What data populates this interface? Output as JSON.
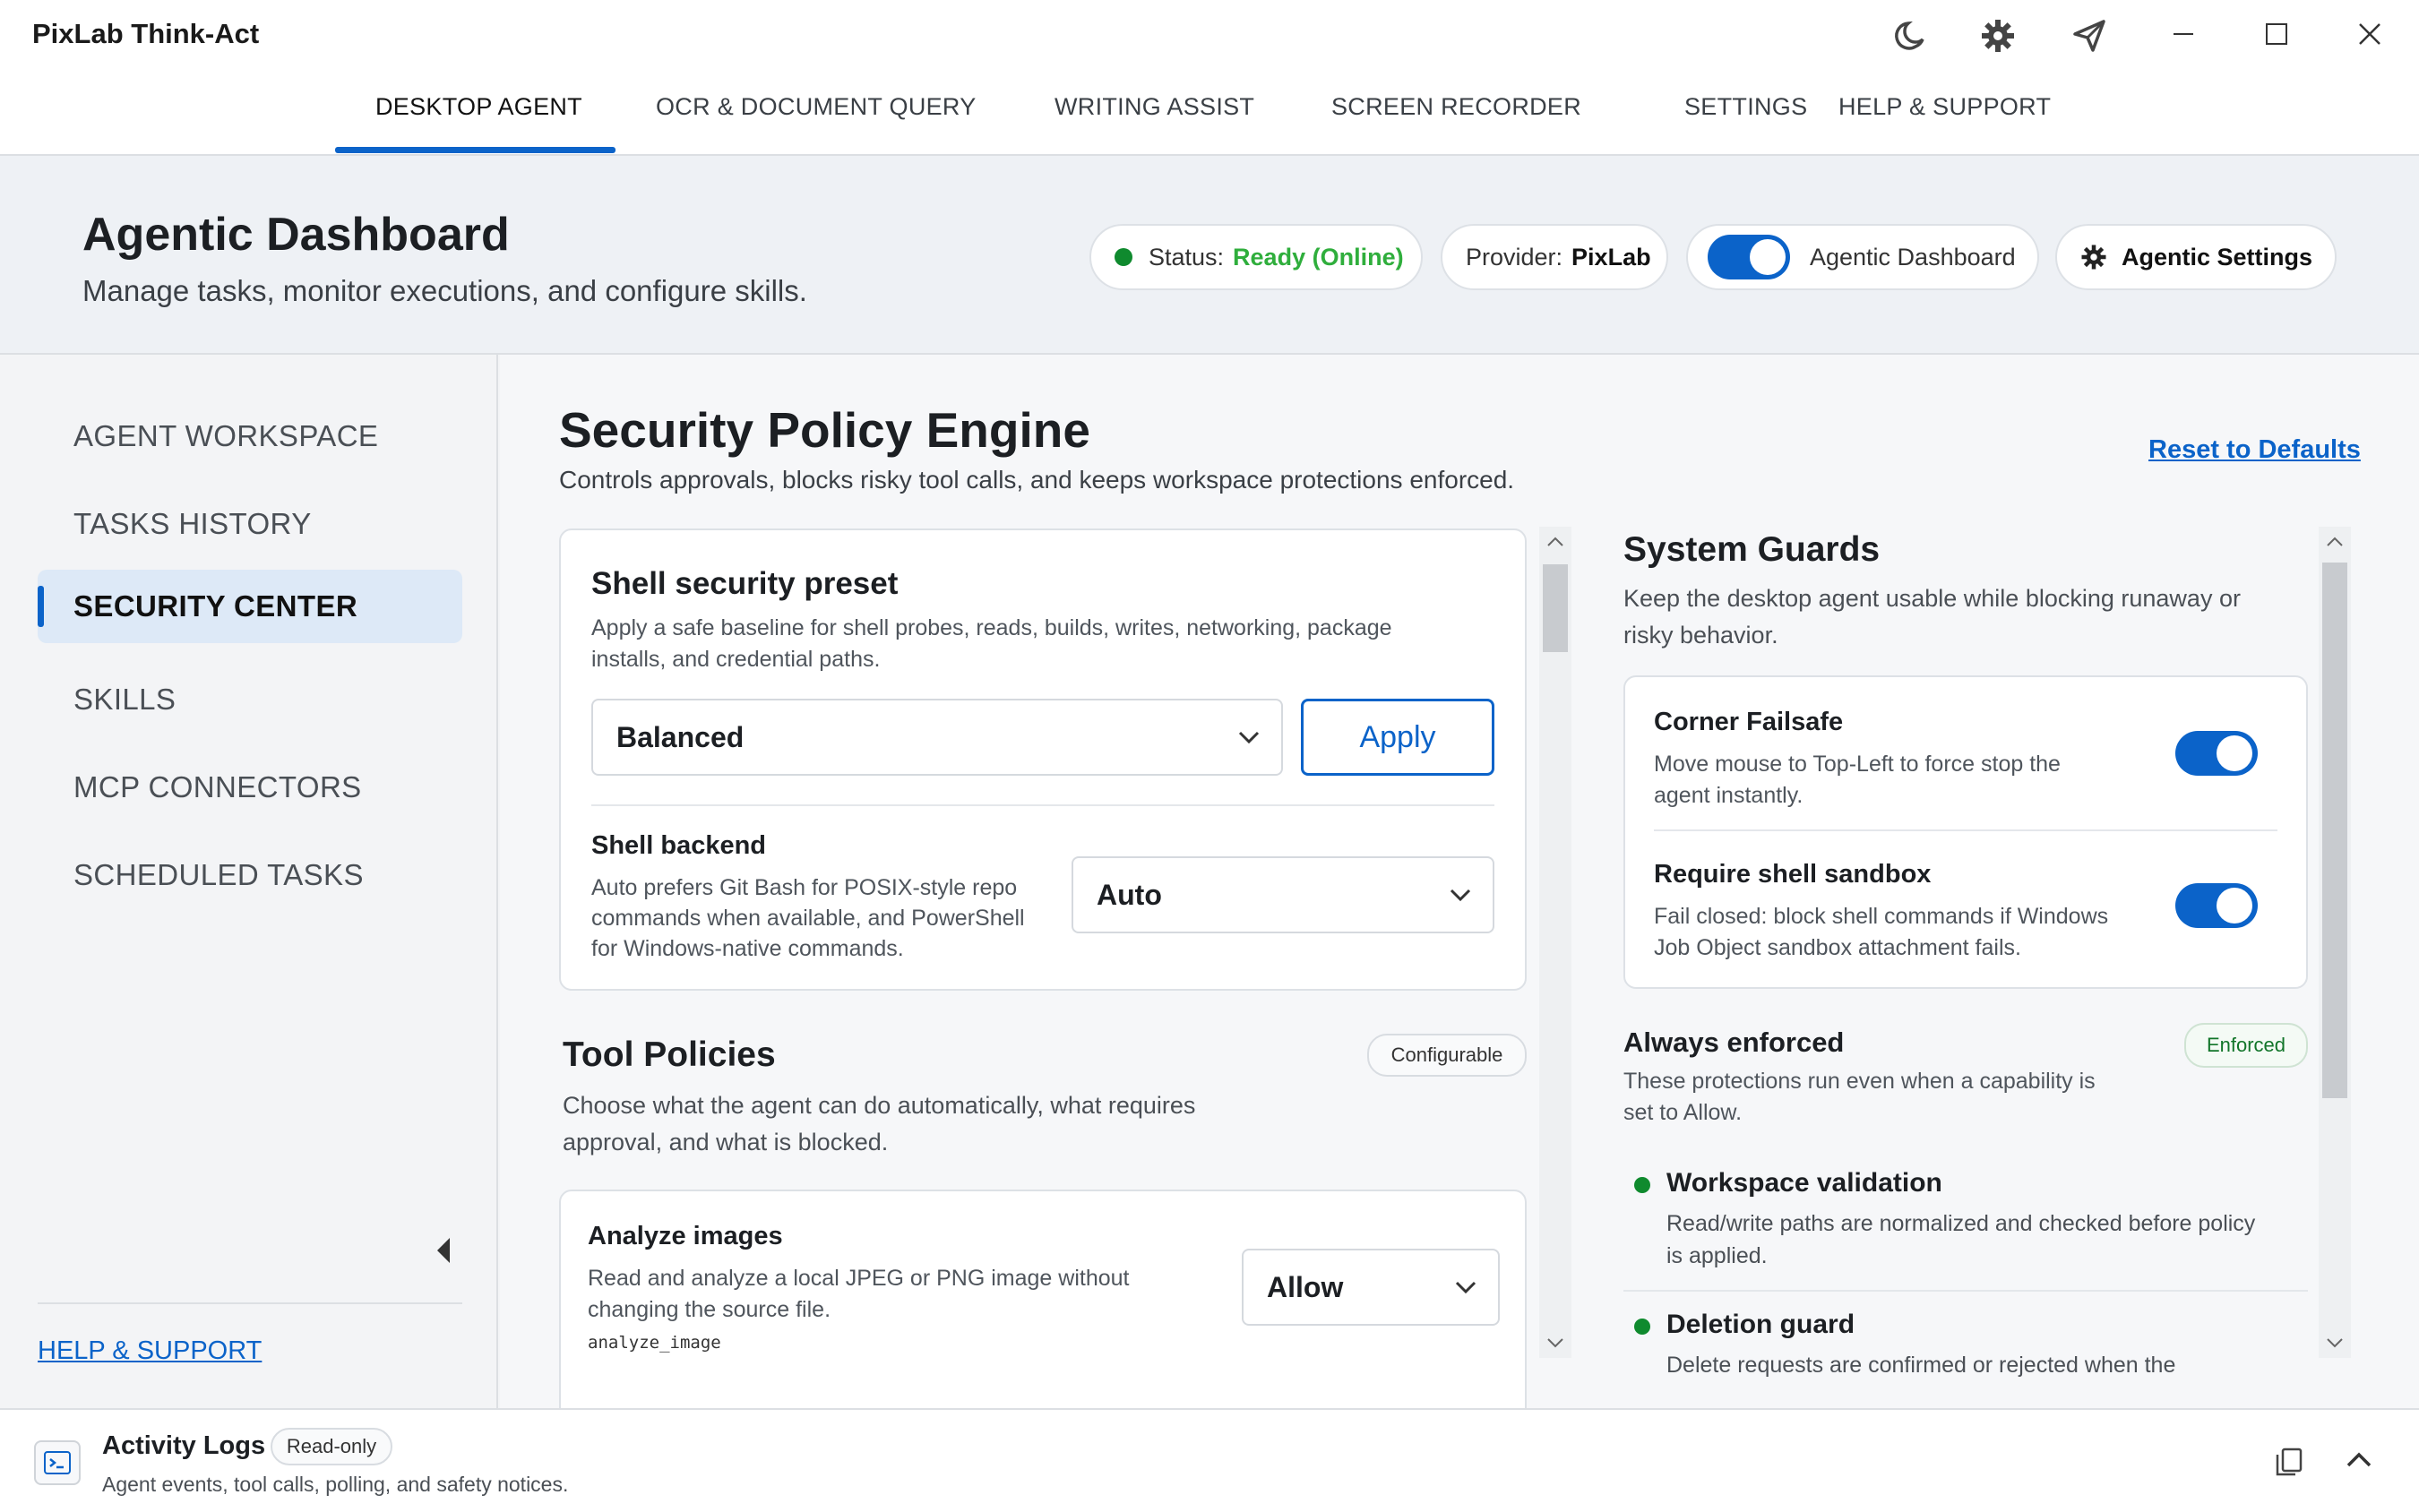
{
  "app": {
    "title": "PixLab Think-Act"
  },
  "titlebar_icons": [
    "moon-icon",
    "gear-icon",
    "send-icon"
  ],
  "window_controls": [
    "minimize",
    "maximize",
    "close"
  ],
  "tabs": [
    {
      "label": "DESKTOP AGENT",
      "active": true
    },
    {
      "label": "OCR & DOCUMENT QUERY",
      "active": false
    },
    {
      "label": "WRITING ASSIST",
      "active": false
    },
    {
      "label": "SCREEN RECORDER",
      "active": false
    },
    {
      "label": "SETTINGS",
      "active": false
    },
    {
      "label": "HELP & SUPPORT",
      "active": false
    }
  ],
  "header": {
    "title": "Agentic Dashboard",
    "subtitle": "Manage tasks, monitor executions, and configure skills.",
    "status_label": "Status:",
    "status_value": "Ready (Online)",
    "provider_label": "Provider:",
    "provider_value": "PixLab",
    "toggle_label": "Agentic Dashboard",
    "toggle_on": true,
    "settings_button": "Agentic Settings"
  },
  "sidebar": {
    "items": [
      {
        "label": "AGENT WORKSPACE",
        "active": false
      },
      {
        "label": "TASKS HISTORY",
        "active": false
      },
      {
        "label": "SECURITY CENTER",
        "active": true
      },
      {
        "label": "SKILLS",
        "active": false
      },
      {
        "label": "MCP CONNECTORS",
        "active": false
      },
      {
        "label": "SCHEDULED TASKS",
        "active": false
      }
    ],
    "help_link": "HELP & SUPPORT"
  },
  "main": {
    "title": "Security Policy Engine",
    "subtitle": "Controls approvals, blocks risky tool calls, and keeps workspace protections enforced.",
    "reset_link": "Reset to Defaults",
    "shell_preset": {
      "title": "Shell security preset",
      "desc1": "Apply a safe baseline for shell probes, reads, builds, writes, networking, package",
      "desc2": "installs, and credential paths.",
      "selected": "Balanced",
      "apply": "Apply",
      "backend_title": "Shell backend",
      "backend_desc1": "Auto prefers Git Bash for POSIX-style repo",
      "backend_desc2": "commands when available, and PowerShell",
      "backend_desc3": "for Windows-native commands.",
      "backend_selected": "Auto"
    },
    "tool_policies": {
      "title": "Tool Policies",
      "badge": "Configurable",
      "desc1": "Choose what the agent can do automatically, what requires",
      "desc2": "approval, and what is blocked.",
      "items": [
        {
          "title": "Analyze images",
          "desc1": "Read and analyze a local JPEG or PNG image without",
          "desc2": "changing the source file.",
          "code": "analyze_image",
          "policy": "Allow"
        }
      ]
    },
    "system_guards": {
      "title": "System Guards",
      "desc1": "Keep the desktop agent usable while blocking runaway or",
      "desc2": "risky behavior.",
      "guards": [
        {
          "title": "Corner Failsafe",
          "desc1": "Move mouse to Top-Left to force stop the",
          "desc2": "agent instantly.",
          "enabled": true
        },
        {
          "title": "Require shell sandbox",
          "desc1": "Fail closed: block shell commands if Windows",
          "desc2": "Job Object sandbox attachment fails.",
          "enabled": true
        }
      ],
      "always_title": "Always enforced",
      "always_badge": "Enforced",
      "always_desc1": "These protections run even when a capability is",
      "always_desc2": "set to Allow.",
      "protections": [
        {
          "title": "Workspace validation",
          "desc1": "Read/write paths are normalized and checked before policy",
          "desc2": "is applied."
        },
        {
          "title": "Deletion guard",
          "desc1": "Delete requests are confirmed or rejected when the",
          "desc2": ""
        }
      ]
    }
  },
  "activity": {
    "title": "Activity Logs",
    "badge": "Read-only",
    "subtitle": "Agent events, tool calls, polling, and safety notices."
  },
  "colors": {
    "accent": "#0b63c9",
    "status_green": "#2fae3c",
    "dot_green": "#0f8a2e"
  }
}
